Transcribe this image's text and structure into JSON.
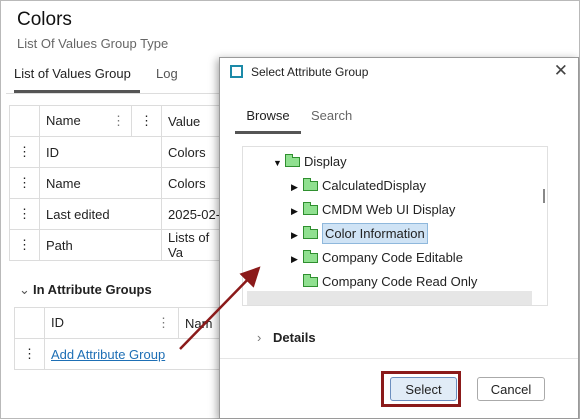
{
  "page": {
    "title": "Colors",
    "subtitle": "List Of Values Group Type",
    "tabs": [
      {
        "label": "List of Values Group"
      },
      {
        "label": "Log"
      }
    ]
  },
  "properties_table": {
    "headers": [
      "Name",
      "Value"
    ],
    "rows": [
      {
        "name": "ID",
        "value": "Colors"
      },
      {
        "name": "Name",
        "value": "Colors"
      },
      {
        "name": "Last edited",
        "value": "2025-02-"
      },
      {
        "name": "Path",
        "value": "Lists of Va"
      }
    ]
  },
  "attribute_groups": {
    "heading": "In Attribute Groups",
    "headers": [
      "ID",
      "Nam"
    ],
    "add_link": "Add Attribute Group"
  },
  "dialog": {
    "title": "Select Attribute Group",
    "tabs": [
      {
        "label": "Browse"
      },
      {
        "label": "Search"
      }
    ],
    "tree": [
      {
        "label": "Display",
        "expanded": true,
        "level": 0
      },
      {
        "label": "CalculatedDisplay",
        "level": 1
      },
      {
        "label": "CMDM Web UI Display",
        "level": 1
      },
      {
        "label": "Color Information",
        "level": 1,
        "selected": true
      },
      {
        "label": "Company Code Editable",
        "level": 1
      },
      {
        "label": "Company Code Read Only",
        "level": 1,
        "leaf": true
      }
    ],
    "details_label": "Details",
    "select_label": "Select",
    "cancel_label": "Cancel"
  },
  "icons": {
    "close": "close-icon",
    "folder": "folder-icon",
    "drag": "drag-handle-icon"
  },
  "colors": {
    "accent": "#1c8aa8",
    "link": "#1e6fb5",
    "highlight": "#8b1a1a",
    "folder": "#90e090"
  }
}
